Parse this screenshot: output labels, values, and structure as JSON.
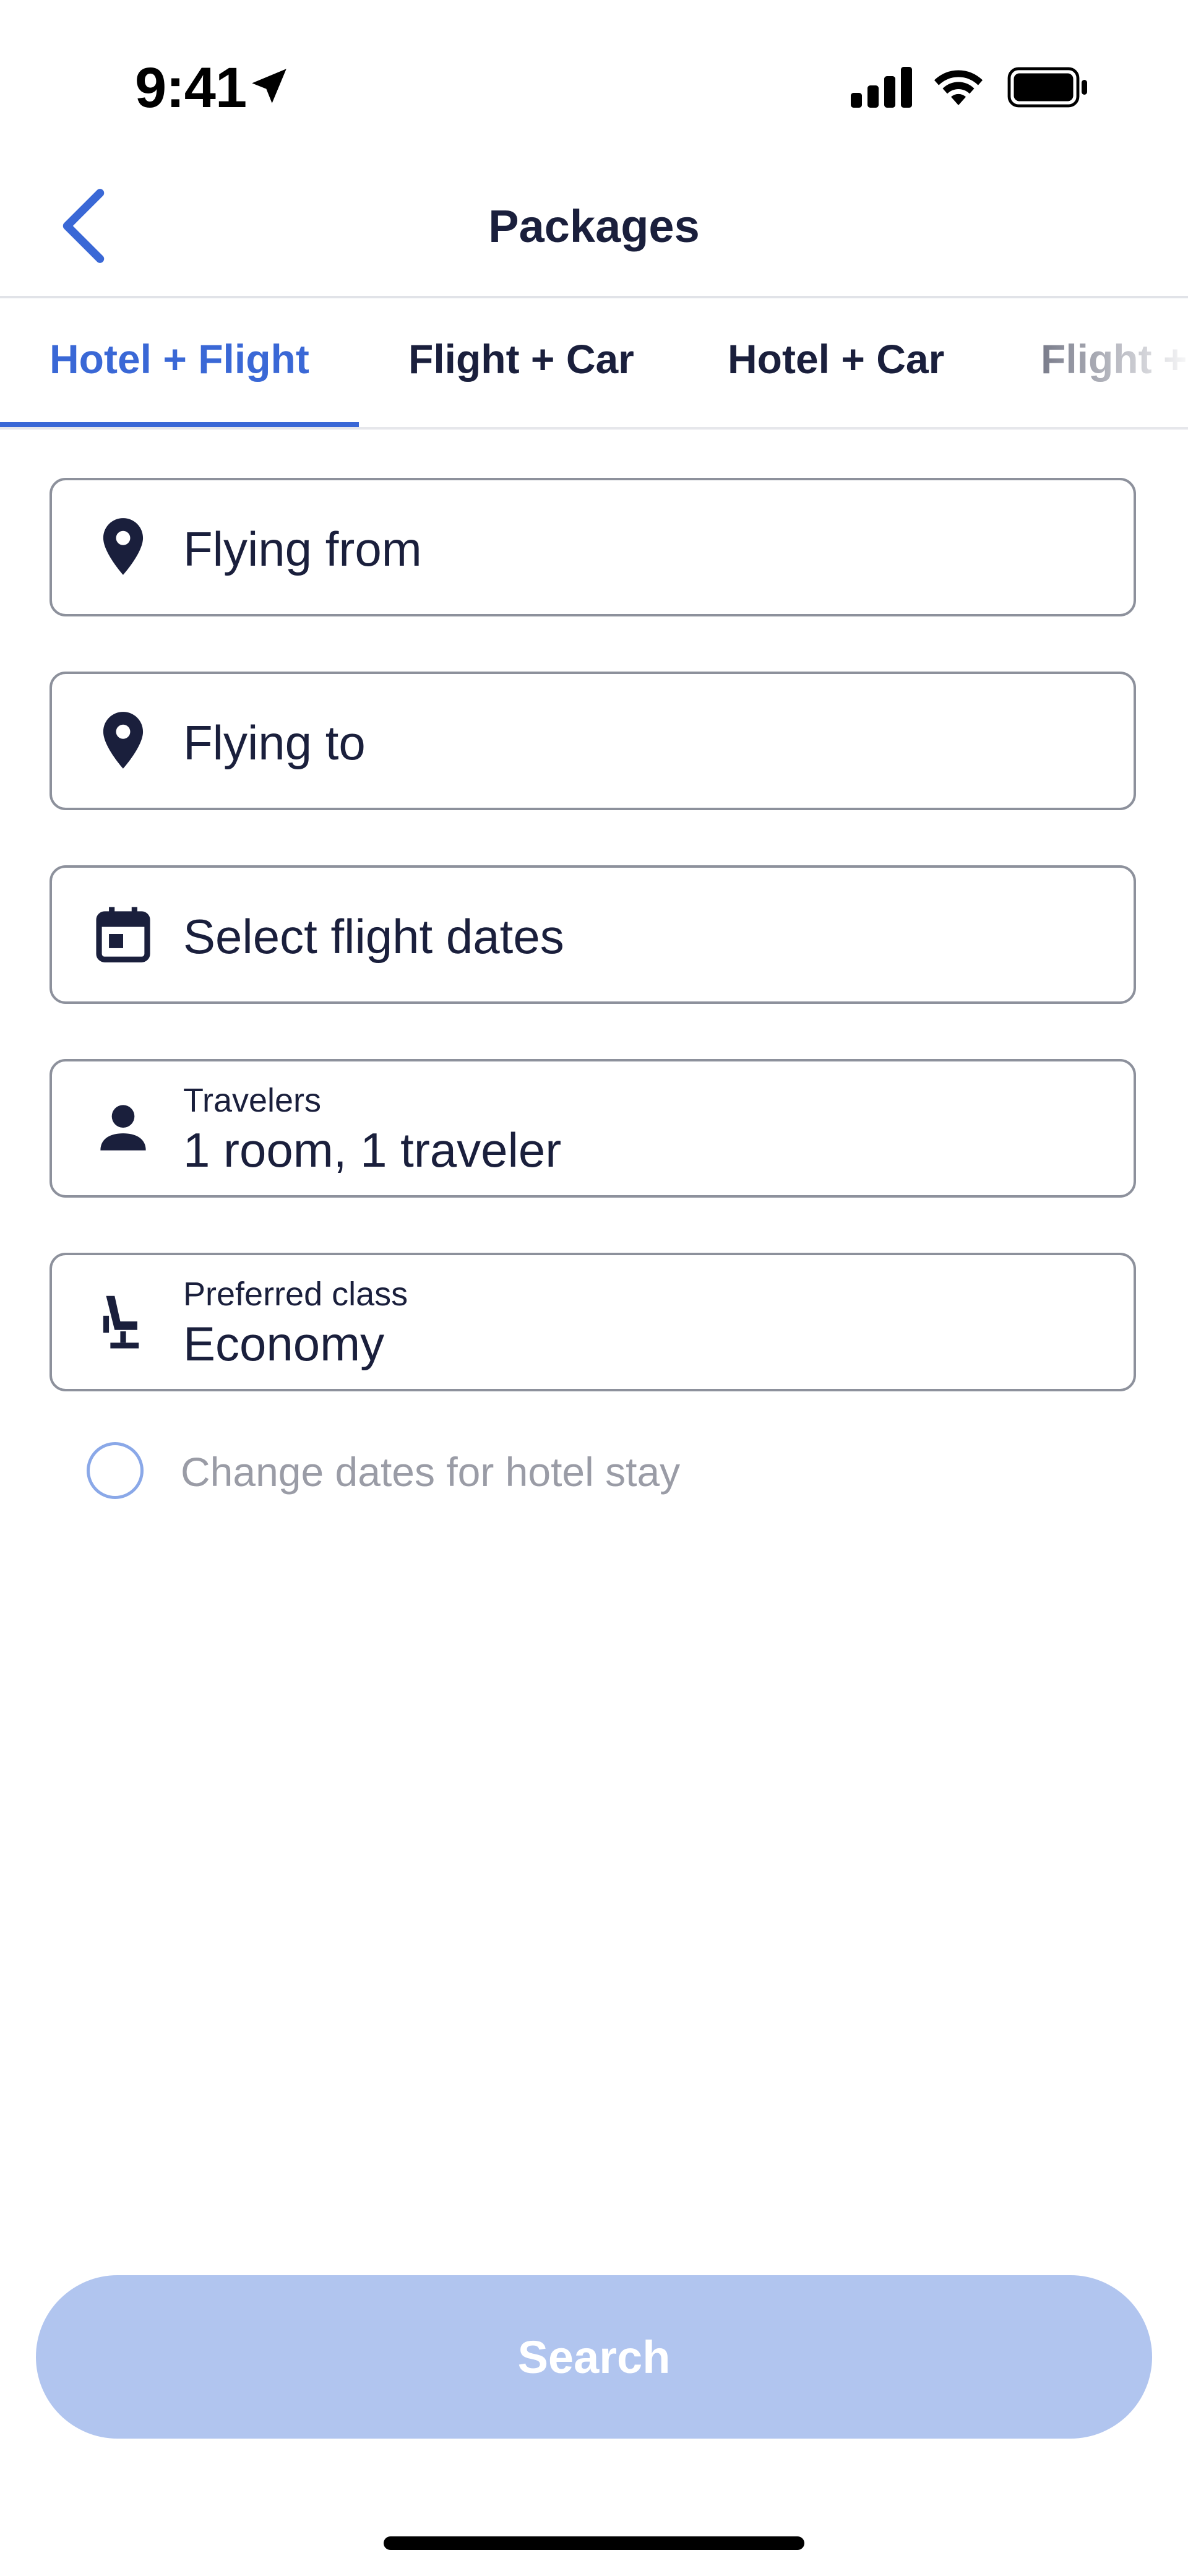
{
  "status_bar": {
    "time": "9:41",
    "icons": [
      "location-arrow-icon",
      "cellular-signal-icon",
      "wifi-icon",
      "battery-icon"
    ]
  },
  "nav": {
    "title": "Packages",
    "back_icon": "chevron-left-icon"
  },
  "tabs": [
    {
      "label": "Hotel + Flight",
      "active": true
    },
    {
      "label": "Flight + Car",
      "active": false
    },
    {
      "label": "Hotel + Car",
      "active": false
    },
    {
      "label": "Flight +",
      "active": false
    }
  ],
  "fields": {
    "flying_from": {
      "placeholder": "Flying from",
      "icon": "map-pin-icon"
    },
    "flying_to": {
      "placeholder": "Flying to",
      "icon": "map-pin-icon"
    },
    "dates": {
      "placeholder": "Select flight dates",
      "icon": "calendar-icon"
    },
    "travelers": {
      "label": "Travelers",
      "value": "1 room, 1 traveler",
      "icon": "person-icon"
    },
    "class": {
      "label": "Preferred class",
      "value": "Economy",
      "icon": "seat-icon"
    }
  },
  "hotel_dates_option": {
    "label": "Change dates for hotel stay",
    "checked": false
  },
  "search_button": {
    "label": "Search",
    "enabled": false
  },
  "colors": {
    "accent": "#3a68d6",
    "text": "#1a1f3c",
    "border": "#8d919c",
    "disabled_button": "#b1c5ef",
    "muted_text": "#9a9ca6"
  }
}
